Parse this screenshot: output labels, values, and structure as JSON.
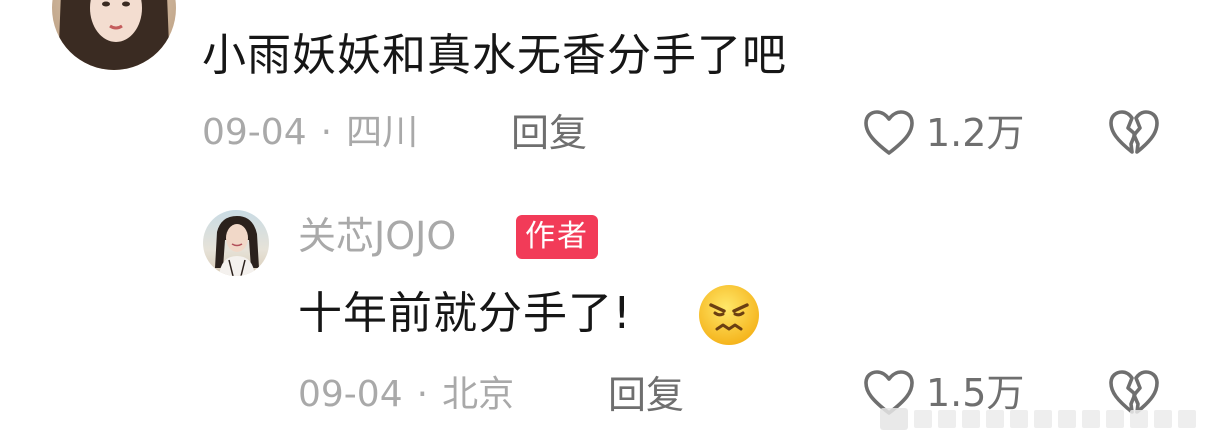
{
  "comments": [
    {
      "text": "小雨妖妖和真水无香分手了吧",
      "date": "09-04",
      "separator": "·",
      "location": "四川",
      "reply_label": "回复",
      "like_count": "1.2万",
      "avatar_icon": "user-avatar-photo"
    }
  ],
  "replies": [
    {
      "author": "关芯JOJO",
      "author_badge": "作者",
      "text": "十年前就分手了!",
      "emoji_icon": "angry-face-emoji",
      "date": "09-04",
      "separator": "·",
      "location": "北京",
      "reply_label": "回复",
      "like_count": "1.5万",
      "avatar_icon": "author-avatar-photo"
    }
  ],
  "icons": {
    "like": "heart-outline-icon",
    "dislike": "broken-heart-icon"
  },
  "colors": {
    "text_primary": "#161616",
    "text_meta": "#a9a9a9",
    "text_action": "#6f6f6f",
    "badge_bg": "#f23b58",
    "badge_text": "#ffffff"
  }
}
